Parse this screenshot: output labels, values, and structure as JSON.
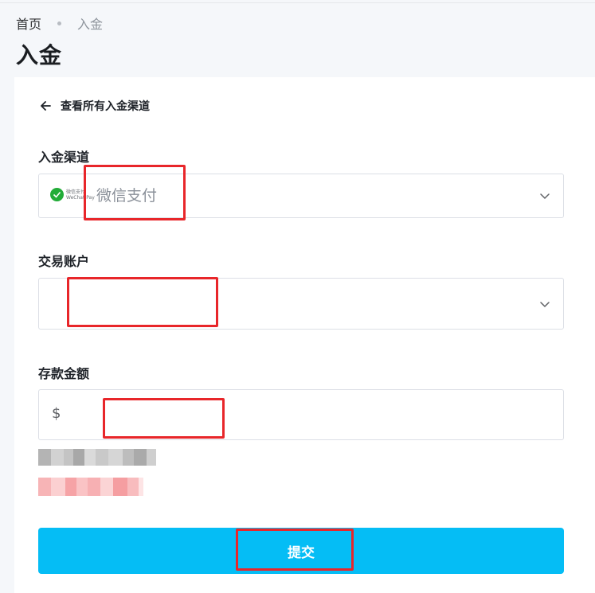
{
  "breadcrumb": {
    "home": "首页",
    "current": "入金"
  },
  "page_title": "入金",
  "back_link": {
    "label": "查看所有入金渠道",
    "icon": "arrow-left-icon"
  },
  "channel": {
    "label": "入金渠道",
    "logo_text_cn": "微信支付",
    "logo_text_en": "WeChat Pay",
    "value": "微信支付",
    "icon": "chevron-down-icon"
  },
  "account": {
    "label": "交易账户",
    "value": "",
    "icon": "chevron-down-icon"
  },
  "amount": {
    "label": "存款金额",
    "currency": "$",
    "value": ""
  },
  "submit": {
    "label": "提交"
  },
  "colors": {
    "accent": "#05bdf5",
    "wechat_green": "#22ac38",
    "highlight_red": "#e8262a"
  }
}
